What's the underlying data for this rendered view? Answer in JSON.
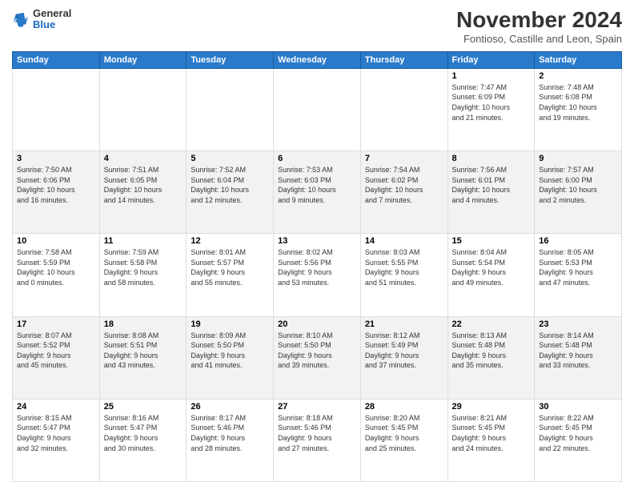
{
  "logo": {
    "general": "General",
    "blue": "Blue"
  },
  "title": "November 2024",
  "subtitle": "Fontioso, Castille and Leon, Spain",
  "header_days": [
    "Sunday",
    "Monday",
    "Tuesday",
    "Wednesday",
    "Thursday",
    "Friday",
    "Saturday"
  ],
  "weeks": [
    {
      "days": [
        {
          "number": "",
          "info": ""
        },
        {
          "number": "",
          "info": ""
        },
        {
          "number": "",
          "info": ""
        },
        {
          "number": "",
          "info": ""
        },
        {
          "number": "",
          "info": ""
        },
        {
          "number": "1",
          "info": "Sunrise: 7:47 AM\nSunset: 6:09 PM\nDaylight: 10 hours\nand 21 minutes."
        },
        {
          "number": "2",
          "info": "Sunrise: 7:48 AM\nSunset: 6:08 PM\nDaylight: 10 hours\nand 19 minutes."
        }
      ]
    },
    {
      "days": [
        {
          "number": "3",
          "info": "Sunrise: 7:50 AM\nSunset: 6:06 PM\nDaylight: 10 hours\nand 16 minutes."
        },
        {
          "number": "4",
          "info": "Sunrise: 7:51 AM\nSunset: 6:05 PM\nDaylight: 10 hours\nand 14 minutes."
        },
        {
          "number": "5",
          "info": "Sunrise: 7:52 AM\nSunset: 6:04 PM\nDaylight: 10 hours\nand 12 minutes."
        },
        {
          "number": "6",
          "info": "Sunrise: 7:53 AM\nSunset: 6:03 PM\nDaylight: 10 hours\nand 9 minutes."
        },
        {
          "number": "7",
          "info": "Sunrise: 7:54 AM\nSunset: 6:02 PM\nDaylight: 10 hours\nand 7 minutes."
        },
        {
          "number": "8",
          "info": "Sunrise: 7:56 AM\nSunset: 6:01 PM\nDaylight: 10 hours\nand 4 minutes."
        },
        {
          "number": "9",
          "info": "Sunrise: 7:57 AM\nSunset: 6:00 PM\nDaylight: 10 hours\nand 2 minutes."
        }
      ]
    },
    {
      "days": [
        {
          "number": "10",
          "info": "Sunrise: 7:58 AM\nSunset: 5:59 PM\nDaylight: 10 hours\nand 0 minutes."
        },
        {
          "number": "11",
          "info": "Sunrise: 7:59 AM\nSunset: 5:58 PM\nDaylight: 9 hours\nand 58 minutes."
        },
        {
          "number": "12",
          "info": "Sunrise: 8:01 AM\nSunset: 5:57 PM\nDaylight: 9 hours\nand 55 minutes."
        },
        {
          "number": "13",
          "info": "Sunrise: 8:02 AM\nSunset: 5:56 PM\nDaylight: 9 hours\nand 53 minutes."
        },
        {
          "number": "14",
          "info": "Sunrise: 8:03 AM\nSunset: 5:55 PM\nDaylight: 9 hours\nand 51 minutes."
        },
        {
          "number": "15",
          "info": "Sunrise: 8:04 AM\nSunset: 5:54 PM\nDaylight: 9 hours\nand 49 minutes."
        },
        {
          "number": "16",
          "info": "Sunrise: 8:05 AM\nSunset: 5:53 PM\nDaylight: 9 hours\nand 47 minutes."
        }
      ]
    },
    {
      "days": [
        {
          "number": "17",
          "info": "Sunrise: 8:07 AM\nSunset: 5:52 PM\nDaylight: 9 hours\nand 45 minutes."
        },
        {
          "number": "18",
          "info": "Sunrise: 8:08 AM\nSunset: 5:51 PM\nDaylight: 9 hours\nand 43 minutes."
        },
        {
          "number": "19",
          "info": "Sunrise: 8:09 AM\nSunset: 5:50 PM\nDaylight: 9 hours\nand 41 minutes."
        },
        {
          "number": "20",
          "info": "Sunrise: 8:10 AM\nSunset: 5:50 PM\nDaylight: 9 hours\nand 39 minutes."
        },
        {
          "number": "21",
          "info": "Sunrise: 8:12 AM\nSunset: 5:49 PM\nDaylight: 9 hours\nand 37 minutes."
        },
        {
          "number": "22",
          "info": "Sunrise: 8:13 AM\nSunset: 5:48 PM\nDaylight: 9 hours\nand 35 minutes."
        },
        {
          "number": "23",
          "info": "Sunrise: 8:14 AM\nSunset: 5:48 PM\nDaylight: 9 hours\nand 33 minutes."
        }
      ]
    },
    {
      "days": [
        {
          "number": "24",
          "info": "Sunrise: 8:15 AM\nSunset: 5:47 PM\nDaylight: 9 hours\nand 32 minutes."
        },
        {
          "number": "25",
          "info": "Sunrise: 8:16 AM\nSunset: 5:47 PM\nDaylight: 9 hours\nand 30 minutes."
        },
        {
          "number": "26",
          "info": "Sunrise: 8:17 AM\nSunset: 5:46 PM\nDaylight: 9 hours\nand 28 minutes."
        },
        {
          "number": "27",
          "info": "Sunrise: 8:18 AM\nSunset: 5:46 PM\nDaylight: 9 hours\nand 27 minutes."
        },
        {
          "number": "28",
          "info": "Sunrise: 8:20 AM\nSunset: 5:45 PM\nDaylight: 9 hours\nand 25 minutes."
        },
        {
          "number": "29",
          "info": "Sunrise: 8:21 AM\nSunset: 5:45 PM\nDaylight: 9 hours\nand 24 minutes."
        },
        {
          "number": "30",
          "info": "Sunrise: 8:22 AM\nSunset: 5:45 PM\nDaylight: 9 hours\nand 22 minutes."
        }
      ]
    }
  ]
}
